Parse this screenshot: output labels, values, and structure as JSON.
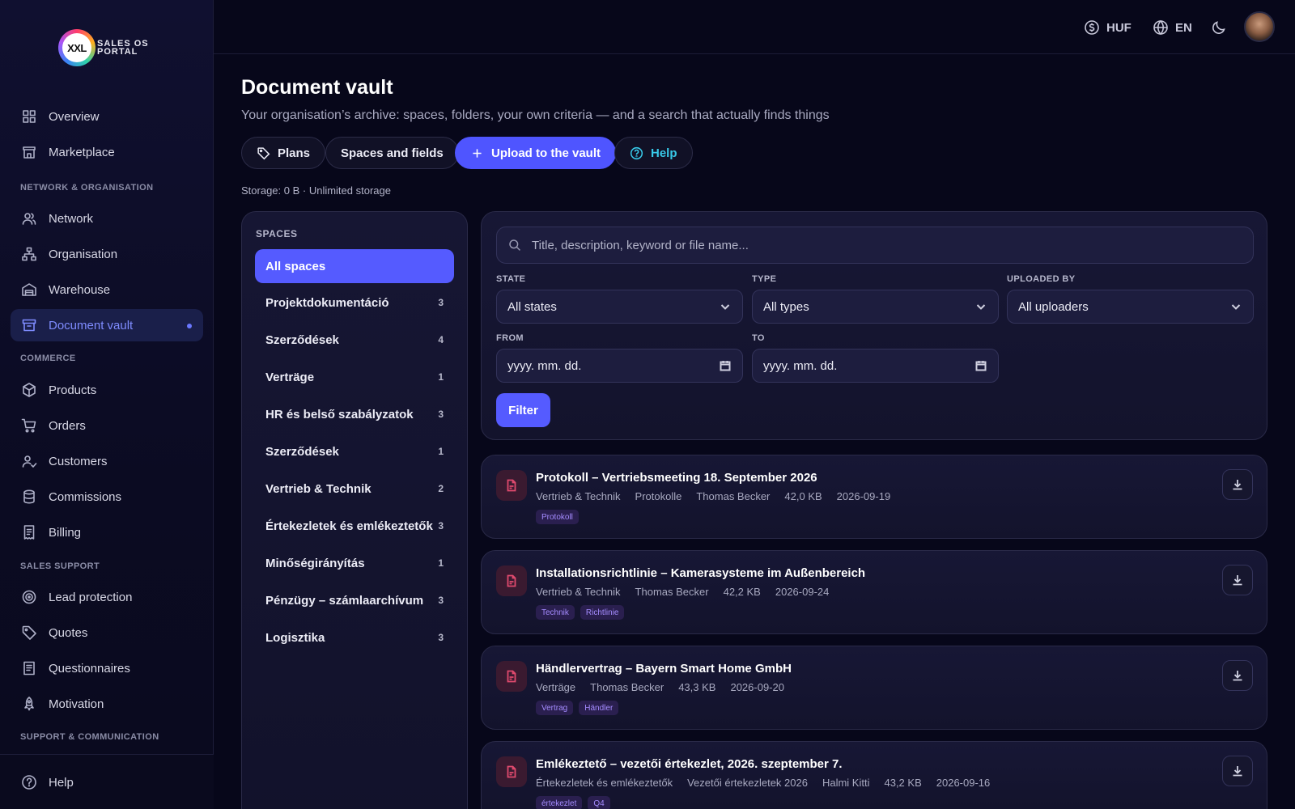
{
  "brand": {
    "mark": "XXL",
    "name_line1": "SALES OS",
    "name_line2": "PORTAL"
  },
  "topbar": {
    "currency": "HUF",
    "language": "EN"
  },
  "sidebar": {
    "overview": "Overview",
    "marketplace": "Marketplace",
    "section_network": "NETWORK & ORGANISATION",
    "network": "Network",
    "organisation": "Organisation",
    "warehouse": "Warehouse",
    "document_vault": "Document vault",
    "section_commerce": "COMMERCE",
    "products": "Products",
    "orders": "Orders",
    "customers": "Customers",
    "commissions": "Commissions",
    "billing": "Billing",
    "section_sales_support": "SALES SUPPORT",
    "lead_protection": "Lead protection",
    "quotes": "Quotes",
    "questionnaires": "Questionnaires",
    "motivation": "Motivation",
    "section_support": "SUPPORT & COMMUNICATION",
    "help": "Help"
  },
  "page": {
    "title": "Document vault",
    "subtitle": "Your organisation’s archive: spaces, folders, your own criteria — and a search that actually finds things",
    "buttons": {
      "plans": "Plans",
      "spaces_fields": "Spaces and fields",
      "upload": "Upload to the vault",
      "help": "Help"
    },
    "storage": "Storage: 0 B · Unlimited storage"
  },
  "spaces": {
    "title": "SPACES",
    "items": [
      {
        "label": "All spaces",
        "count": ""
      },
      {
        "label": "Projektdokumentáció",
        "count": "3"
      },
      {
        "label": "Szerződések",
        "count": "4"
      },
      {
        "label": "Verträge",
        "count": "1"
      },
      {
        "label": "HR és belső szabályzatok",
        "count": "3"
      },
      {
        "label": "Szerződések",
        "count": "1"
      },
      {
        "label": "Vertrieb & Technik",
        "count": "2"
      },
      {
        "label": "Értekezletek és emlékeztetők",
        "count": "3"
      },
      {
        "label": "Minőségirányítás",
        "count": "1"
      },
      {
        "label": "Pénzügy – számlaarchívum",
        "count": "3"
      },
      {
        "label": "Logisztika",
        "count": "3"
      }
    ]
  },
  "filters": {
    "search_placeholder": "Title, description, keyword or file name...",
    "state_label": "STATE",
    "state_value": "All states",
    "type_label": "TYPE",
    "type_value": "All types",
    "uploader_label": "UPLOADED BY",
    "uploader_value": "All uploaders",
    "from_label": "FROM",
    "from_placeholder": "yyyy. mm. dd.",
    "to_label": "TO",
    "to_placeholder": "yyyy. mm. dd.",
    "filter_button": "Filter"
  },
  "documents": [
    {
      "title": "Protokoll – Vertriebsmeeting 18. September 2026",
      "meta": [
        "Vertrieb & Technik",
        "Protokolle",
        "Thomas Becker",
        "42,0 KB",
        "2026-09-19"
      ],
      "tags": [
        "Protokoll"
      ]
    },
    {
      "title": "Installationsrichtlinie – Kamerasysteme im Außenbereich",
      "meta": [
        "Vertrieb & Technik",
        "Thomas Becker",
        "42,2 KB",
        "2026-09-24"
      ],
      "tags": [
        "Technik",
        "Richtlinie"
      ]
    },
    {
      "title": "Händlervertrag – Bayern Smart Home GmbH",
      "meta": [
        "Verträge",
        "Thomas Becker",
        "43,3 KB",
        "2026-09-20"
      ],
      "tags": [
        "Vertrag",
        "Händler"
      ]
    },
    {
      "title": "Emlékeztető – vezetői értekezlet, 2026. szeptember 7.",
      "meta": [
        "Értekezletek és emlékeztetők",
        "Vezetői értekezletek 2026",
        "Halmi Kitti",
        "43,2 KB",
        "2026-09-16"
      ],
      "tags": [
        "értekezlet",
        "Q4"
      ]
    }
  ],
  "icons": [
    "overview-icon",
    "marketplace-icon",
    "network-icon",
    "organisation-icon",
    "warehouse-icon",
    "archive-icon",
    "products-icon",
    "cart-icon",
    "customers-icon",
    "database-icon",
    "billing-icon",
    "target-icon",
    "tag-icon",
    "clipboard-icon",
    "rocket-icon",
    "help-icon",
    "search-icon",
    "chevron-down-icon",
    "calendar-icon",
    "file-icon",
    "download-icon",
    "dollar-icon",
    "globe-icon",
    "moon-icon",
    "plus-icon"
  ],
  "colors": {
    "accent": "#555bff",
    "help_cyan": "#38c9e8",
    "tag_purple": "#a58cff",
    "doc_icon_red": "#e04a6e"
  }
}
